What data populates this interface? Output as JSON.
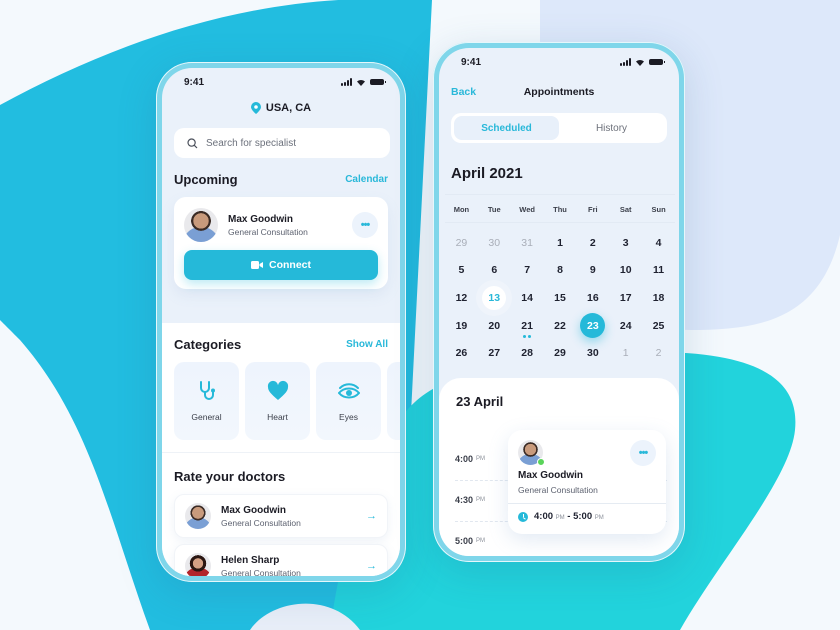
{
  "colors": {
    "accent": "#25b9d9",
    "blob_primary": "#22bde0",
    "blob_teal": "#22d3dc",
    "blob_lavender": "#dde8fa",
    "background": "#f4f9fd",
    "online": "#5ad45a"
  },
  "home": {
    "status_time": "9:41",
    "location": {
      "icon": "map-pin-icon",
      "label": "USA, CA"
    },
    "search": {
      "icon": "search-icon",
      "placeholder": "Search for specialist"
    },
    "upcoming": {
      "title": "Upcoming",
      "link": "Calendar",
      "card": {
        "name": "Max Goodwin",
        "subtitle": "General Consultation",
        "more_icon": "more-horizontal-icon",
        "connect_label": "Connect",
        "connect_icon": "video-camera-icon"
      }
    },
    "categories": {
      "title": "Categories",
      "link": "Show All",
      "items": [
        {
          "label": "General",
          "icon": "stethoscope-icon"
        },
        {
          "label": "Heart",
          "icon": "heart-icon"
        },
        {
          "label": "Eyes",
          "icon": "eye-icon"
        },
        {
          "label": "",
          "icon": ""
        }
      ]
    },
    "rate": {
      "title": "Rate your doctors",
      "items": [
        {
          "name": "Max Goodwin",
          "subtitle": "General Consultation",
          "icon": "arrow-right-icon"
        },
        {
          "name": "Helen Sharp",
          "subtitle": "General Consultation",
          "icon": "arrow-right-icon"
        }
      ]
    }
  },
  "appointments": {
    "status_time": "9:41",
    "back_label": "Back",
    "title": "Appointments",
    "tabs": [
      {
        "label": "Scheduled",
        "active": true
      },
      {
        "label": "History",
        "active": false
      }
    ],
    "month": "April 2021",
    "weekdays": [
      "Mon",
      "Tue",
      "Wed",
      "Thu",
      "Fri",
      "Sat",
      "Sun"
    ],
    "days": [
      {
        "d": "29",
        "muted": true
      },
      {
        "d": "30",
        "muted": true
      },
      {
        "d": "31",
        "muted": true
      },
      {
        "d": "1"
      },
      {
        "d": "2"
      },
      {
        "d": "3"
      },
      {
        "d": "4"
      },
      {
        "d": "5"
      },
      {
        "d": "6"
      },
      {
        "d": "7"
      },
      {
        "d": "8"
      },
      {
        "d": "9"
      },
      {
        "d": "10"
      },
      {
        "d": "11"
      },
      {
        "d": "12"
      },
      {
        "d": "13",
        "today": true
      },
      {
        "d": "14"
      },
      {
        "d": "15"
      },
      {
        "d": "16"
      },
      {
        "d": "17"
      },
      {
        "d": "18"
      },
      {
        "d": "19"
      },
      {
        "d": "20"
      },
      {
        "d": "21",
        "dots": 2
      },
      {
        "d": "22"
      },
      {
        "d": "23",
        "selected": true
      },
      {
        "d": "24"
      },
      {
        "d": "25"
      },
      {
        "d": "26"
      },
      {
        "d": "27"
      },
      {
        "d": "28"
      },
      {
        "d": "29"
      },
      {
        "d": "30"
      },
      {
        "d": "1",
        "muted": true
      },
      {
        "d": "2",
        "muted": true
      }
    ],
    "schedule": {
      "date_title": "23 April",
      "time_slots": [
        {
          "time": "4:00",
          "period": "PM"
        },
        {
          "time": "4:30",
          "period": "PM"
        },
        {
          "time": "5:00",
          "period": "PM"
        }
      ],
      "appointment": {
        "name": "Max Goodwin",
        "subtitle": "General Consultation",
        "status": "online",
        "start": "4:00",
        "start_period": "PM",
        "separator": "-",
        "end": "5:00",
        "end_period": "PM",
        "clock_icon": "clock-icon",
        "more_icon": "more-horizontal-icon"
      }
    }
  }
}
